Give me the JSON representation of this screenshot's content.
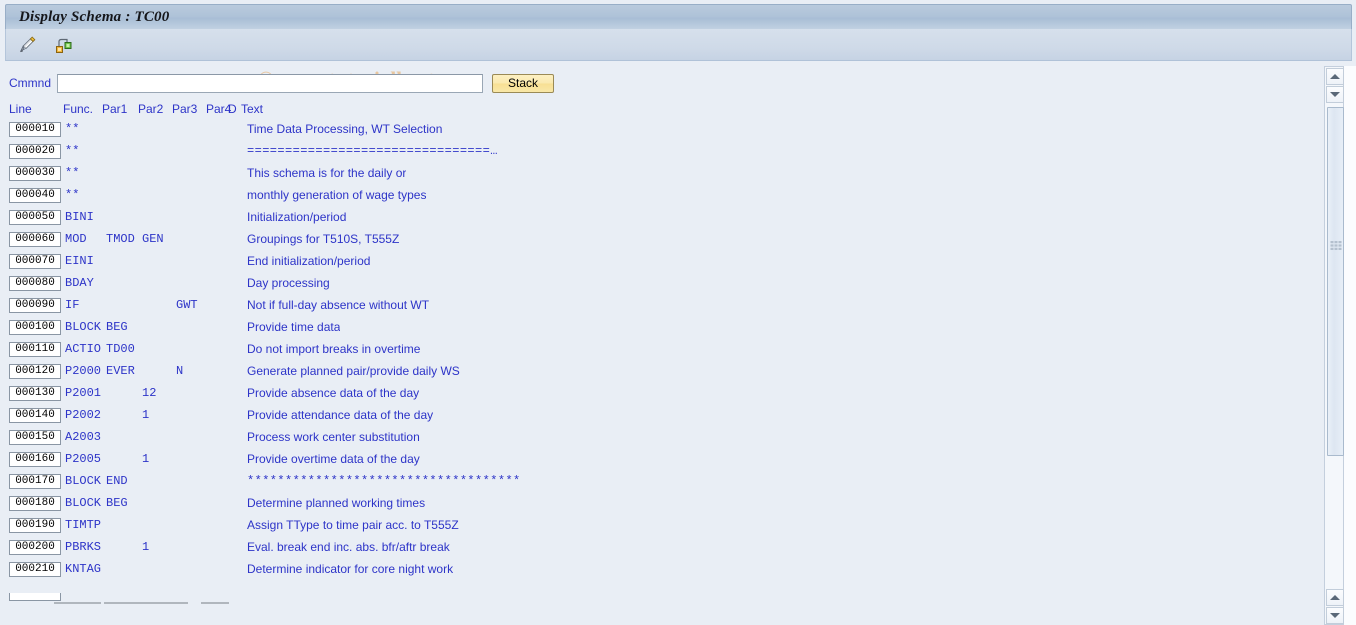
{
  "window": {
    "title": "Display Schema : TC00"
  },
  "toolbar": {
    "icons": [
      {
        "name": "edit-pencil-icon",
        "label": "Change"
      },
      {
        "name": "schema-hierarchy-icon",
        "label": "Structure"
      }
    ]
  },
  "watermark": {
    "text": "© www.tutorialkart.com",
    "color": "#e8c49b"
  },
  "command": {
    "label": "Cmmnd",
    "value": "",
    "placeholder": "",
    "stack_label": "Stack"
  },
  "grid": {
    "columns": [
      "Line",
      "Func.",
      "Par1",
      "Par2",
      "Par3",
      "Par4",
      "D",
      "Text"
    ],
    "rows": [
      {
        "line": "000010",
        "func": "**",
        "par1": "",
        "par2": "",
        "par3": "",
        "par4": "",
        "d": "",
        "text": "Time Data Processing, WT Selection",
        "mono": false
      },
      {
        "line": "000020",
        "func": "**",
        "par1": "",
        "par2": "",
        "par3": "",
        "par4": "",
        "d": "",
        "text": "================================…",
        "mono": true
      },
      {
        "line": "000030",
        "func": "**",
        "par1": "",
        "par2": "",
        "par3": "",
        "par4": "",
        "d": "",
        "text": "This schema is for the daily or",
        "mono": false
      },
      {
        "line": "000040",
        "func": "**",
        "par1": "",
        "par2": "",
        "par3": "",
        "par4": "",
        "d": "",
        "text": "monthly generation of wage types",
        "mono": false
      },
      {
        "line": "000050",
        "func": "BINI",
        "par1": "",
        "par2": "",
        "par3": "",
        "par4": "",
        "d": "",
        "text": "Initialization/period",
        "mono": false
      },
      {
        "line": "000060",
        "func": "MOD",
        "par1": "TMOD",
        "par2": "GEN",
        "par3": "",
        "par4": "",
        "d": "",
        "text": "Groupings for T510S, T555Z",
        "mono": false
      },
      {
        "line": "000070",
        "func": "EINI",
        "par1": "",
        "par2": "",
        "par3": "",
        "par4": "",
        "d": "",
        "text": "End initialization/period",
        "mono": false
      },
      {
        "line": "000080",
        "func": "BDAY",
        "par1": "",
        "par2": "",
        "par3": "",
        "par4": "",
        "d": "",
        "text": "Day processing",
        "mono": false
      },
      {
        "line": "000090",
        "func": "IF",
        "par1": "",
        "par2": "",
        "par3": "GWT",
        "par4": "",
        "d": "",
        "text": "Not if full-day absence without WT",
        "mono": false
      },
      {
        "line": "000100",
        "func": "BLOCK",
        "par1": "BEG",
        "par2": "",
        "par3": "",
        "par4": "",
        "d": "",
        "text": "Provide time data",
        "mono": false
      },
      {
        "line": "000110",
        "func": "ACTIO",
        "par1": "TD00",
        "par2": "",
        "par3": "",
        "par4": "",
        "d": "",
        "text": "Do not import breaks in overtime",
        "mono": false
      },
      {
        "line": "000120",
        "func": "P2000",
        "par1": "EVER",
        "par2": "",
        "par3": "N",
        "par4": "",
        "d": "",
        "text": "Generate planned pair/provide daily WS",
        "mono": false
      },
      {
        "line": "000130",
        "func": "P2001",
        "par1": "",
        "par2": "12",
        "par3": "",
        "par4": "",
        "d": "",
        "text": "Provide absence data of the day",
        "mono": false
      },
      {
        "line": "000140",
        "func": "P2002",
        "par1": "",
        "par2": "1",
        "par3": "",
        "par4": "",
        "d": "",
        "text": "Provide attendance data of the day",
        "mono": false
      },
      {
        "line": "000150",
        "func": "A2003",
        "par1": "",
        "par2": "",
        "par3": "",
        "par4": "",
        "d": "",
        "text": "Process work center substitution",
        "mono": false
      },
      {
        "line": "000160",
        "func": "P2005",
        "par1": "",
        "par2": "1",
        "par3": "",
        "par4": "",
        "d": "",
        "text": "Provide overtime data of the day",
        "mono": false
      },
      {
        "line": "000170",
        "func": "BLOCK",
        "par1": "END",
        "par2": "",
        "par3": "",
        "par4": "",
        "d": "",
        "text": "************************************",
        "mono": true
      },
      {
        "line": "000180",
        "func": "BLOCK",
        "par1": "BEG",
        "par2": "",
        "par3": "",
        "par4": "",
        "d": "",
        "text": "Determine planned working times",
        "mono": false
      },
      {
        "line": "000190",
        "func": "TIMTP",
        "par1": "",
        "par2": "",
        "par3": "",
        "par4": "",
        "d": "",
        "text": "Assign TType to time pair acc. to T555Z",
        "mono": false
      },
      {
        "line": "000200",
        "func": "PBRKS",
        "par1": "",
        "par2": "1",
        "par3": "",
        "par4": "",
        "d": "",
        "text": "Eval. break end inc. abs. bfr/aftr break",
        "mono": false
      },
      {
        "line": "000210",
        "func": "KNTAG",
        "par1": "",
        "par2": "",
        "par3": "",
        "par4": "",
        "d": "",
        "text": "Determine indicator for core night work",
        "mono": false
      }
    ]
  },
  "scrollbars": {
    "inner": {
      "name": "grid-vertical-scrollbar",
      "thumb_top_pct": 7,
      "thumb_height_pct": 67
    },
    "outer": {
      "name": "page-vertical-scrollbar"
    }
  },
  "colors": {
    "text_blue": "#2d34c8",
    "background": "#e9eef5",
    "title_bar": "#aec2d8",
    "button_yellow": "#f7df93"
  }
}
